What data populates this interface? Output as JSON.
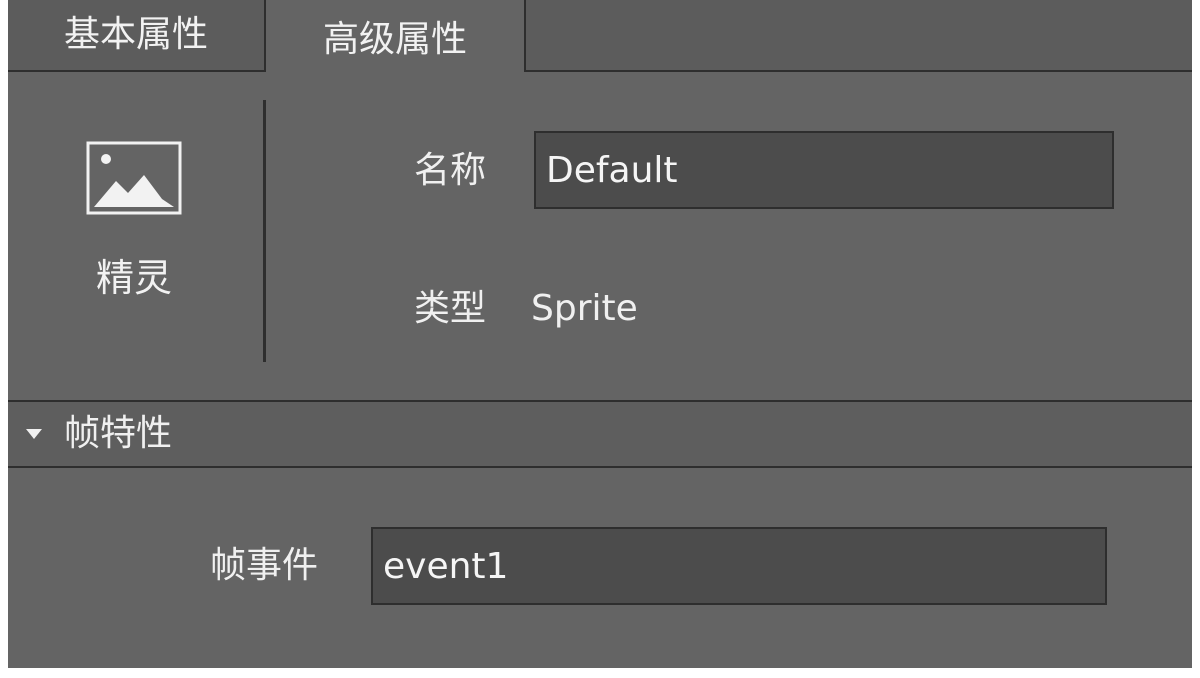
{
  "tabs": {
    "basic_label": "基本属性",
    "advanced_label": "高级属性",
    "active": "advanced"
  },
  "sprite": {
    "icon": "image-icon",
    "label": "精灵"
  },
  "fields": {
    "name_label": "名称",
    "name_value": "Default",
    "type_label": "类型",
    "type_value": "Sprite"
  },
  "frame_section": {
    "expanded_icon": "triangle-down-icon",
    "title": "帧特性",
    "event_label": "帧事件",
    "event_value": "event1"
  },
  "colors": {
    "panel_bg": "#646464",
    "input_bg": "#4c4c4c",
    "border": "#2e2e2e",
    "text": "#f0f0f0"
  }
}
